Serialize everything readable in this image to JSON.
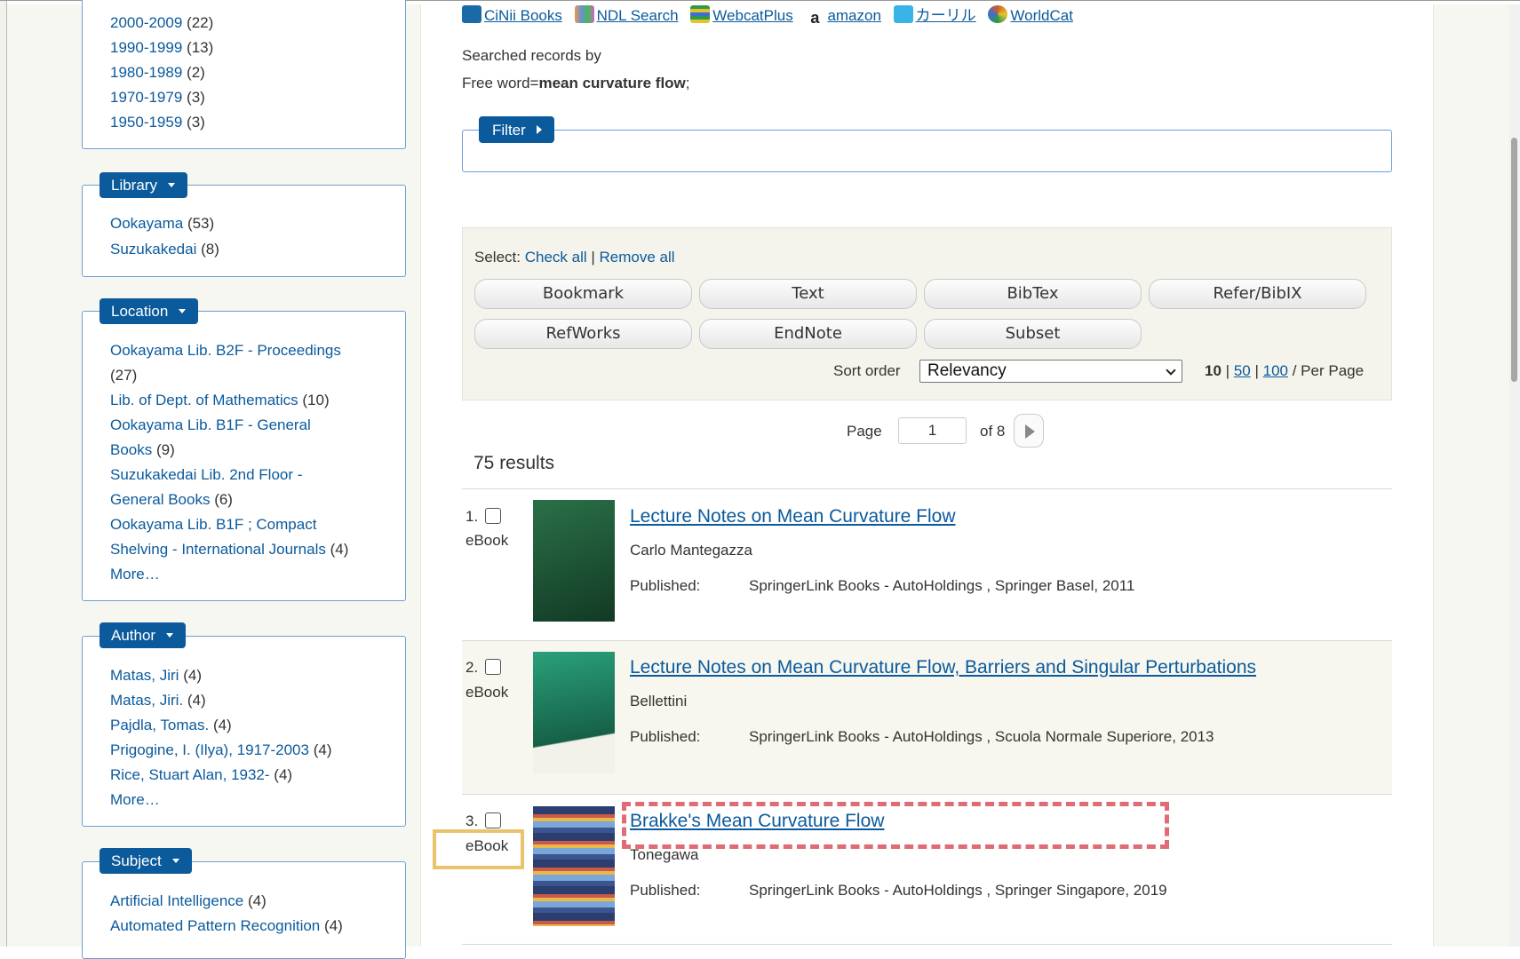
{
  "top_links": [
    {
      "label": "CiNii Books",
      "icon": "cinii-icon",
      "color": "#1a6aa8"
    },
    {
      "label": "NDL Search",
      "icon": "ndl-icon",
      "color": "#6c8fd9"
    },
    {
      "label": "WebcatPlus",
      "icon": "webcat-icon",
      "color": "#2c9a4a"
    },
    {
      "label": "amazon",
      "icon": "amazon-icon",
      "color": "#222222"
    },
    {
      "label": "カーリル",
      "icon": "calil-icon",
      "color": "#3ab3e6"
    },
    {
      "label": "WorldCat",
      "icon": "worldcat-icon",
      "color": "#d05a2a"
    }
  ],
  "search_info": {
    "line1": "Searched records by",
    "prefix": "Free word=",
    "term": "mean curvature flow",
    "suffix": ";"
  },
  "filter": {
    "label": "Filter"
  },
  "sidebar": {
    "years": [
      {
        "label": "2000-2009",
        "count": "(22)"
      },
      {
        "label": "1990-1999",
        "count": "(13)"
      },
      {
        "label": "1980-1989",
        "count": "(2)"
      },
      {
        "label": "1970-1979",
        "count": "(3)"
      },
      {
        "label": "1950-1959",
        "count": "(3)"
      }
    ],
    "library": {
      "title": "Library",
      "items": [
        {
          "label": "Ookayama",
          "count": "(53)"
        },
        {
          "label": "Suzukakedai",
          "count": "(8)"
        }
      ]
    },
    "location": {
      "title": "Location",
      "lines": [
        {
          "label": "Ookayama Lib. B2F - Proceedings",
          "count": ""
        },
        {
          "label": "",
          "count": "(27)"
        },
        {
          "label": "Lib. of Dept. of Mathematics",
          "count": "(10)"
        },
        {
          "label": "Ookayama Lib. B1F - General",
          "count": ""
        },
        {
          "label": "Books",
          "count": "(9)"
        },
        {
          "label": "Suzukakedai Lib. 2nd Floor -",
          "count": ""
        },
        {
          "label": "General Books",
          "count": "(6)"
        },
        {
          "label": "Ookayama Lib. B1F ; Compact",
          "count": ""
        },
        {
          "label": "Shelving - International Journals",
          "count": "(4)"
        }
      ],
      "more": "More…"
    },
    "author": {
      "title": "Author",
      "items": [
        {
          "label": "Matas, Jiri",
          "count": "(4)"
        },
        {
          "label": "Matas, Jiri.",
          "count": "(4)"
        },
        {
          "label": "Pajdla, Tomas.",
          "count": "(4)"
        },
        {
          "label": "Prigogine, I. (Ilya), 1917-2003",
          "count": "(4)"
        },
        {
          "label": "Rice, Stuart Alan, 1932-",
          "count": "(4)"
        }
      ],
      "more": "More…"
    },
    "subject": {
      "title": "Subject",
      "items": [
        {
          "label": "Artificial Intelligence",
          "count": "(4)"
        },
        {
          "label": "Automated Pattern Recognition",
          "count": "(4)"
        }
      ]
    }
  },
  "toolbar": {
    "select_label": "Select:",
    "check_all": "Check all",
    "sep": "|",
    "remove_all": "Remove all",
    "buttons_row1": [
      "Bookmark",
      "Text",
      "BibTex",
      "Refer/BibIX"
    ],
    "buttons_row2": [
      "RefWorks",
      "EndNote",
      "Subset"
    ],
    "sort_label": "Sort order",
    "sort_value": "Relevancy",
    "per_page": {
      "current": "10",
      "opt1": "50",
      "opt2": "100",
      "suffix": "/ Per Page",
      "sep": "|"
    }
  },
  "pager": {
    "label": "Page",
    "value": "1",
    "of": "of 8"
  },
  "results_count": "75 results",
  "results": [
    {
      "num": "1.",
      "type": "eBook",
      "title": "Lecture Notes on Mean Curvature Flow",
      "author": "Carlo Mantegazza",
      "published_label": "Published:",
      "published": "SpringerLink Books - AutoHoldings , Springer Basel, 2011",
      "cover_color": "#1e5a38"
    },
    {
      "num": "2.",
      "type": "eBook",
      "title": "Lecture Notes on Mean Curvature Flow, Barriers and Singular Perturbations",
      "author": "Bellettini",
      "published_label": "Published:",
      "published": "SpringerLink Books - AutoHoldings , Scuola Normale Superiore, 2013",
      "cover_color": "#1d7a60"
    },
    {
      "num": "3.",
      "type": "eBook",
      "title": "Brakke's Mean Curvature Flow",
      "author": "Tonegawa",
      "published_label": "Published:",
      "published": "SpringerLink Books - AutoHoldings , Springer Singapore, 2019",
      "cover_color": "#2b3e6e"
    }
  ]
}
